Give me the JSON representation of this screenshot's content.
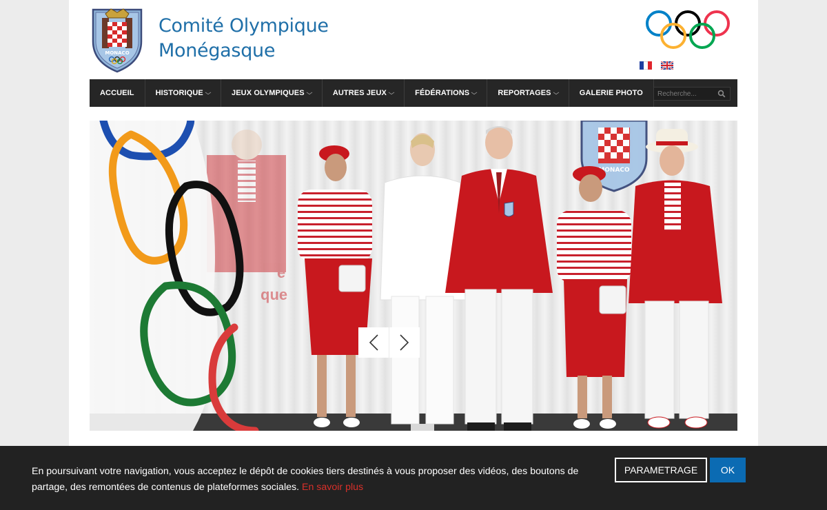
{
  "header": {
    "title_line1": "Comité Olympique",
    "title_line2": "Monégasque",
    "crest_text": "MONACO",
    "languages": [
      {
        "code": "fr",
        "icon": "flag-fr-icon"
      },
      {
        "code": "en",
        "icon": "flag-uk-icon"
      }
    ]
  },
  "nav": {
    "items": [
      {
        "label": "ACCUEIL",
        "dropdown": false
      },
      {
        "label": "HISTORIQUE",
        "dropdown": true
      },
      {
        "label": "JEUX OLYMPIQUES",
        "dropdown": true
      },
      {
        "label": "AUTRES JEUX",
        "dropdown": true
      },
      {
        "label": "FÉDÉRATIONS",
        "dropdown": true
      },
      {
        "label": "REPORTAGES",
        "dropdown": true
      },
      {
        "label": "GALERIE PHOTO",
        "dropdown": false
      }
    ],
    "search_placeholder": "Recherche..."
  },
  "slider": {
    "backdrop_text": [
      "e",
      "que"
    ],
    "crest_text": "MONACO"
  },
  "cookie": {
    "text": "En poursuivant votre navigation, vous acceptez le dépôt de cookies tiers destinés à vous proposer des vidéos, des boutons de partage, des remontées de contenus de plateformes sociales.",
    "link": "En savoir plus",
    "param_button": "PARAMETRAGE",
    "ok_button": "OK"
  },
  "colors": {
    "title_blue": "#1f6fa8",
    "nav_bg": "#262626",
    "cookie_bg": "#222222",
    "ok_blue": "#0b6bb3",
    "link_red": "#d9302a",
    "blazer_red": "#c8181e"
  }
}
